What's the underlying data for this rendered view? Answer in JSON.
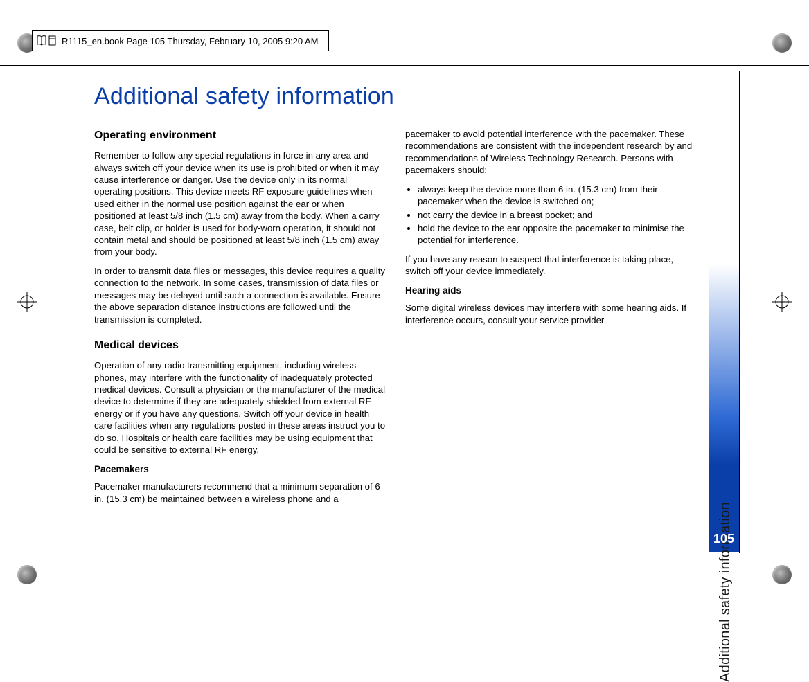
{
  "header": {
    "text": "R1115_en.book  Page 105  Thursday, February 10, 2005  9:20 AM"
  },
  "side": {
    "label": "Additional safety information",
    "page_number": "105"
  },
  "title": "Additional safety information",
  "sections": {
    "op_env": {
      "heading": "Operating environment",
      "p1": "Remember to follow any special regulations in force in any area and always switch off your device when its use is prohibited or when it may cause interference or danger. Use the device only in its normal operating positions. This device meets RF exposure guidelines when used either in the normal use position against the ear or when positioned at least 5/8 inch (1.5 cm) away from the body. When a carry case, belt clip, or holder is used for body-worn operation, it should not contain metal and should be positioned at least 5/8 inch (1.5 cm) away from your body.",
      "p2": "In order to transmit data files or messages, this device requires a quality connection to the network. In some cases, transmission of data files or messages may be delayed until such a connection is available. Ensure the above separation distance instructions are followed until the transmission is completed."
    },
    "med": {
      "heading": "Medical devices",
      "p1": "Operation of any radio transmitting equipment, including wireless phones, may interfere with the functionality of inadequately protected medical devices. Consult a physician or the manufacturer of the medical device to determine if they are adequately shielded from external RF energy or if you have any questions. Switch off your device in health care facilities when any regulations posted in these areas instruct you to do so. Hospitals or health care facilities may be using equipment that could be sensitive to external RF energy.",
      "pacemakers_h": "Pacemakers",
      "pacemakers_p": "Pacemaker manufacturers recommend that a minimum separation of 6 in. (15.3 cm) be maintained between a wireless phone and a pacemaker to avoid potential interference with the pacemaker. These recommendations are consistent with the independent research by and recommendations of Wireless Technology Research. Persons with pacemakers should:",
      "bullets": [
        "always keep the device more than 6 in. (15.3 cm) from their pacemaker when the device is switched on;",
        "not carry the device in a breast pocket; and",
        "hold the device to the ear opposite the pacemaker to minimise the potential for interference."
      ],
      "pacemakers_p2": "If you have any reason to suspect that interference is taking place, switch off your device immediately.",
      "hearing_h": "Hearing aids",
      "hearing_p": "Some digital wireless devices may interfere with some hearing aids. If interference occurs, consult your service provider."
    }
  }
}
